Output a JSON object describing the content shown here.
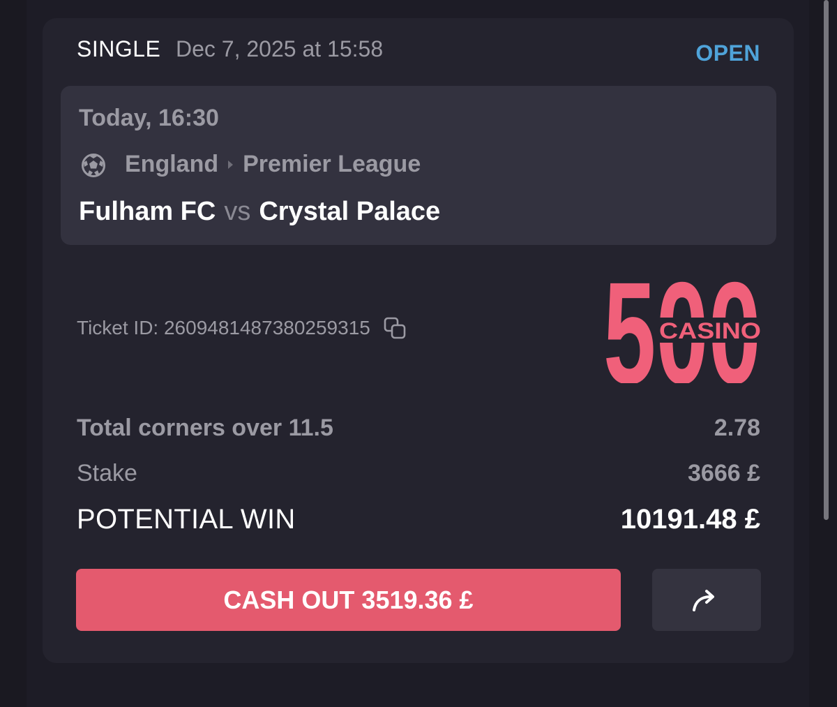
{
  "bet": {
    "type": "SINGLE",
    "placed_at": "Dec 7, 2025 at 15:58",
    "status": "OPEN"
  },
  "event": {
    "time": "Today, 16:30",
    "sport_icon": "soccer-ball-icon",
    "country": "England",
    "league": "Premier League",
    "home_team": "Fulham FC",
    "vs": "vs",
    "away_team": "Crystal Palace"
  },
  "ticket": {
    "label": "Ticket ID: 260948148738025931​5",
    "copy_icon": "copy-icon"
  },
  "brand": {
    "logo_text": "500",
    "logo_subtext": "CASINO",
    "color": "#f0607a"
  },
  "selection": {
    "market": "Total corners over 11.5",
    "odds": "2.78"
  },
  "stake": {
    "label": "Stake",
    "value": "3666 £"
  },
  "potential_win": {
    "label": "POTENTIAL WIN",
    "value": "10191.48 £"
  },
  "actions": {
    "cashout_label": "CASH OUT 3519.36 £",
    "share_icon": "share-arrow-icon"
  },
  "colors": {
    "accent_open": "#4fa3d9",
    "cashout": "#e45a6e"
  }
}
